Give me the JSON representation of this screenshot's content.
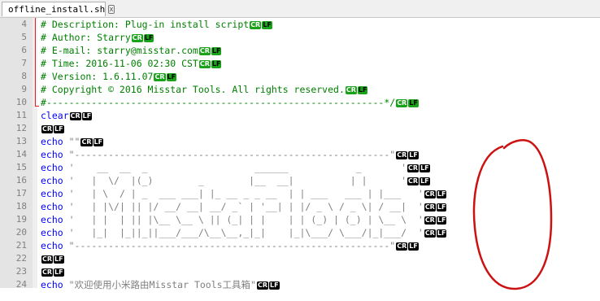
{
  "tab": {
    "filename": "offline_install.sh",
    "close_glyph": "x"
  },
  "eol": {
    "cr": "CR",
    "lf": "LF"
  },
  "colors": {
    "keyword": "#0000ff",
    "comment": "#008000",
    "string": "#808080",
    "eol_badge_comment": "#1aa21a",
    "eol_badge_code": "#000000",
    "annotation_circle": "#cc1111"
  },
  "lines": [
    {
      "num": "4",
      "cls": "comment",
      "parts": [
        {
          "t": "cm",
          "v": "# Description: Plug-in install script"
        }
      ]
    },
    {
      "num": "5",
      "cls": "comment",
      "parts": [
        {
          "t": "cm",
          "v": "# Author: Starry"
        }
      ]
    },
    {
      "num": "6",
      "cls": "comment",
      "parts": [
        {
          "t": "cm",
          "v": "# E-mail: starry@misstar.com"
        }
      ]
    },
    {
      "num": "7",
      "cls": "comment",
      "parts": [
        {
          "t": "cm",
          "v": "# Time: 2016-11-06 02:30 CST"
        }
      ]
    },
    {
      "num": "8",
      "cls": "comment",
      "parts": [
        {
          "t": "cm",
          "v": "# Version: 1.6.11.07"
        }
      ]
    },
    {
      "num": "9",
      "cls": "comment",
      "parts": [
        {
          "t": "cm",
          "v": "# Copyright © 2016 Misstar Tools. All rights reserved."
        }
      ]
    },
    {
      "num": "10",
      "cls": "comment",
      "parts": [
        {
          "t": "cm",
          "v": "#------------------------------------------------------------*/"
        }
      ]
    },
    {
      "num": "11",
      "cls": "code",
      "parts": [
        {
          "t": "kw",
          "v": "clear"
        }
      ]
    },
    {
      "num": "12",
      "cls": "code",
      "parts": []
    },
    {
      "num": "13",
      "cls": "code",
      "parts": [
        {
          "t": "kw",
          "v": "echo"
        },
        {
          "t": "str",
          "v": " \"\""
        }
      ]
    },
    {
      "num": "14",
      "cls": "code",
      "parts": [
        {
          "t": "kw",
          "v": "echo"
        },
        {
          "t": "str",
          "v": " \"--------------------------------------------------------\""
        }
      ]
    },
    {
      "num": "15",
      "cls": "code",
      "parts": [
        {
          "t": "kw",
          "v": "echo"
        },
        {
          "t": "str",
          "v": " '    __  __  _                   ______            _       '"
        }
      ]
    },
    {
      "num": "16",
      "cls": "code",
      "parts": [
        {
          "t": "kw",
          "v": "echo"
        },
        {
          "t": "str",
          "v": " '   |  \\/  |(_)        _        |__  __|          | |      '"
        }
      ]
    },
    {
      "num": "17",
      "cls": "code",
      "parts": [
        {
          "t": "kw",
          "v": "echo"
        },
        {
          "t": "str",
          "v": " '   | \\  / | _  ___ ___| |_ __ _ _ __  | | ___   ___ | |___   '"
        }
      ]
    },
    {
      "num": "18",
      "cls": "code",
      "parts": [
        {
          "t": "kw",
          "v": "echo"
        },
        {
          "t": "str",
          "v": " '   | |\\/| || |/ __/ __| __/ _` | '__| | |/ _ \\ / _ \\| / __|  '"
        }
      ]
    },
    {
      "num": "19",
      "cls": "code",
      "parts": [
        {
          "t": "kw",
          "v": "echo"
        },
        {
          "t": "str",
          "v": " '   | |  | || |\\__ \\__ \\ || (_| | |    | | (_) | (_) | \\__ \\  '"
        }
      ]
    },
    {
      "num": "20",
      "cls": "code",
      "parts": [
        {
          "t": "kw",
          "v": "echo"
        },
        {
          "t": "str",
          "v": " '   |_|  |_||_||___/___/\\__\\__,_|_|    |_|\\___/ \\___/|_|___/  '"
        }
      ]
    },
    {
      "num": "21",
      "cls": "code",
      "parts": [
        {
          "t": "kw",
          "v": "echo"
        },
        {
          "t": "str",
          "v": " \"--------------------------------------------------------\""
        }
      ]
    },
    {
      "num": "22",
      "cls": "code",
      "parts": []
    },
    {
      "num": "23",
      "cls": "code",
      "parts": []
    },
    {
      "num": "24",
      "cls": "code",
      "parts": [
        {
          "t": "kw",
          "v": "echo"
        },
        {
          "t": "str",
          "v": " \"欢迎使用小米路由Misstar Tools工具箱\""
        }
      ]
    }
  ]
}
